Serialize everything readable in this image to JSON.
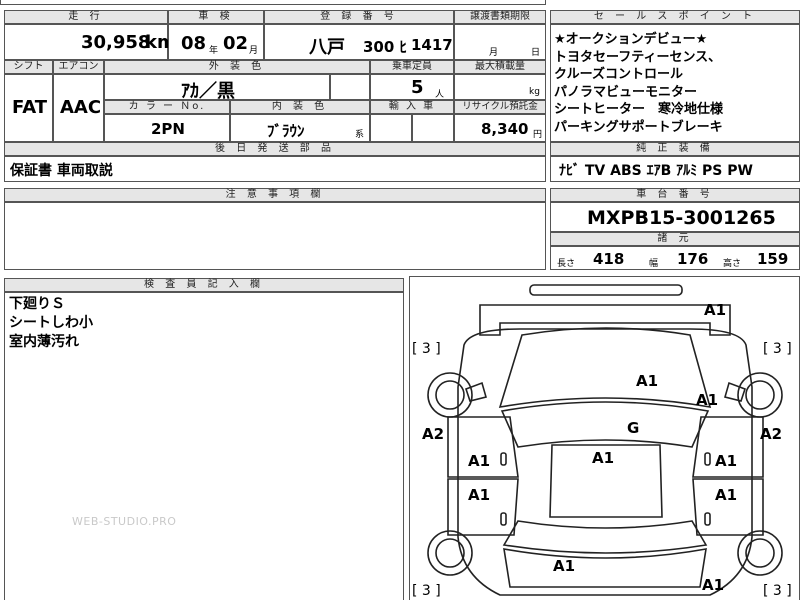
{
  "top_headers": {
    "mileage": "走 行",
    "inspection": "車 検",
    "registration": "登 録 番 号",
    "transfer_deadline": "譲渡書類期限",
    "sales_points": "セ ー ル ス ポ イ ン ト"
  },
  "mileage": {
    "value": "30,958",
    "unit": "km"
  },
  "inspection": {
    "year": "08",
    "year_unit": "年",
    "month": "02",
    "month_unit": "月"
  },
  "registration": {
    "region": "八戸",
    "class_kana": "300 ﾋ",
    "number": "1417"
  },
  "transfer_deadline": {
    "month_unit": "月",
    "day_unit": "日"
  },
  "row2_headers": {
    "shift": "シフト",
    "aircon": "エアコン",
    "exterior_color": "外 装 色",
    "capacity": "乗車定員",
    "max_load": "最大積載量"
  },
  "shift": "FAT",
  "aircon": "AAC",
  "exterior_color": "ｱｶ／黒",
  "capacity": {
    "value": "5",
    "unit": "人"
  },
  "max_load": {
    "unit": "kg"
  },
  "row3_headers": {
    "color_no": "カ ラ ー Ｎo.",
    "interior_color": "内 装 色",
    "import": "輸 入 車",
    "recycle_fee": "リサイクル預託金"
  },
  "color_no": "2PN",
  "interior_color": {
    "value": "ﾌﾞﾗｳﾝ",
    "suffix": "系"
  },
  "recycle_fee": {
    "value": "8,340",
    "unit": "円"
  },
  "sales_points": [
    "★オークションデビュー★",
    "トヨタセーフティーセンス、",
    "クルーズコントロール",
    "パノラマビューモニター",
    "シートヒーター　寒冷地仕様",
    "パーキングサポートブレーキ"
  ],
  "parts_to_ship": {
    "header": "後 日 発 送 部 品",
    "value": "保証書 車両取説"
  },
  "genuine_equipment": {
    "header": "純 正 装 備",
    "value": "ﾅﾋﾞ TV ABS ｴｱB ｱﾙﾐ PS PW"
  },
  "notes": {
    "header": "注 意 事 項 欄"
  },
  "chassis": {
    "header": "車 台 番 号",
    "value": "MXPB15-3001265"
  },
  "dimensions": {
    "header": "諸 元",
    "length_label": "長さ",
    "length": "418",
    "width_label": "幅",
    "width": "176",
    "height_label": "高さ",
    "height": "159"
  },
  "inspector": {
    "header": "検 査 員 記 入 欄",
    "remarks": [
      "下廻りＳ",
      "シートしわ小",
      "室内薄汚れ"
    ]
  },
  "watermark": "WEB-STUDIO.PRO",
  "damage_marks": {
    "tire_front_left": "[ 3 ]",
    "tire_front_right": "[ 3 ]",
    "tire_rear_left": "[ 3 ]",
    "tire_rear_right": "[ 3 ]",
    "front_right_fender": "A1",
    "hood": "A1",
    "front_right_door_area": "A1",
    "left_side": "A2",
    "right_side": "A2",
    "windshield": "G",
    "roof": "A1",
    "front_left_door": "A1",
    "front_right_door": "A1",
    "rear_left_door": "A1",
    "rear_right_door": "A1",
    "rear_bumper": "A1",
    "rear_right_quarter": "A1"
  },
  "colors": {
    "header_bg": "#e6e6e6",
    "border": "#555555"
  }
}
